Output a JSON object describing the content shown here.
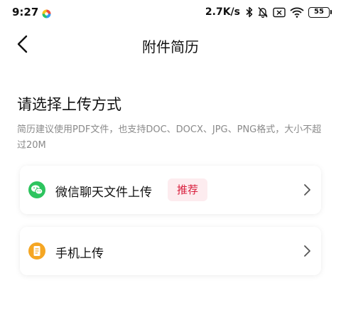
{
  "status_bar": {
    "time": "9:27",
    "net_speed": "2.7K/s",
    "battery": "55",
    "icons": [
      "app-notification-icon",
      "bluetooth-icon",
      "mute-icon",
      "sim-off-icon",
      "wifi-icon",
      "battery-icon"
    ]
  },
  "header": {
    "title": "附件简历",
    "back_icon": "chevron-left-icon"
  },
  "section": {
    "title": "请选择上传方式",
    "description": "简历建议使用PDF文件，也支持DOC、DOCX、JPG、PNG格式，大小不超过20M"
  },
  "options": [
    {
      "label": "微信聊天文件上传",
      "badge": "推荐",
      "icon": "wechat-icon",
      "icon_color": "#2dc45e"
    },
    {
      "label": "手机上传",
      "icon": "phone-file-icon",
      "icon_color": "#f5a623"
    }
  ],
  "colors": {
    "badge_bg": "#fdecef",
    "badge_text": "#d81e3c",
    "secondary_text": "#8a8a8a"
  }
}
